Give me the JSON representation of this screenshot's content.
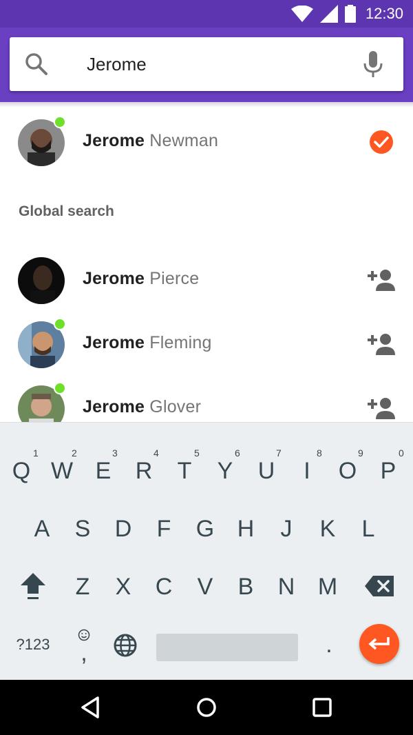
{
  "status_bar": {
    "time": "12:30",
    "icons": [
      "wifi-icon",
      "signal-icon",
      "battery-icon"
    ]
  },
  "search": {
    "value": "Jerome",
    "icons": [
      "search-icon",
      "mic-icon"
    ]
  },
  "colors": {
    "app_bar": "#6a3fc2",
    "status_bar": "#5e35b1",
    "accent": "#ff5722",
    "online": "#6ee02b"
  },
  "top_result": {
    "first_name": "Jerome",
    "last_name": "Newman",
    "online": true,
    "selected": true
  },
  "section_label": "Global search",
  "global_results": [
    {
      "first_name": "Jerome",
      "last_name": "Pierce",
      "online": false,
      "action": "add-person-icon"
    },
    {
      "first_name": "Jerome",
      "last_name": "Fleming",
      "online": true,
      "action": "add-person-icon"
    },
    {
      "first_name": "Jerome",
      "last_name": "Glover",
      "online": true,
      "action": "add-person-icon"
    }
  ],
  "keyboard": {
    "row1": [
      "Q",
      "W",
      "E",
      "R",
      "T",
      "Y",
      "U",
      "I",
      "O",
      "P"
    ],
    "row1_numbers": [
      "1",
      "2",
      "3",
      "4",
      "5",
      "6",
      "7",
      "8",
      "9",
      "0"
    ],
    "row2": [
      "A",
      "S",
      "D",
      "F",
      "G",
      "H",
      "J",
      "K",
      "L"
    ],
    "row3": [
      "Z",
      "X",
      "C",
      "V",
      "B",
      "N",
      "M"
    ],
    "symbols_key": "?123",
    "comma_key": ",",
    "period_key": ".",
    "special_icons": [
      "shift-icon",
      "backspace-icon",
      "emoji-icon",
      "globe-icon",
      "enter-icon"
    ]
  },
  "nav_bar": {
    "icons": [
      "back-icon",
      "home-icon",
      "recents-icon"
    ]
  }
}
